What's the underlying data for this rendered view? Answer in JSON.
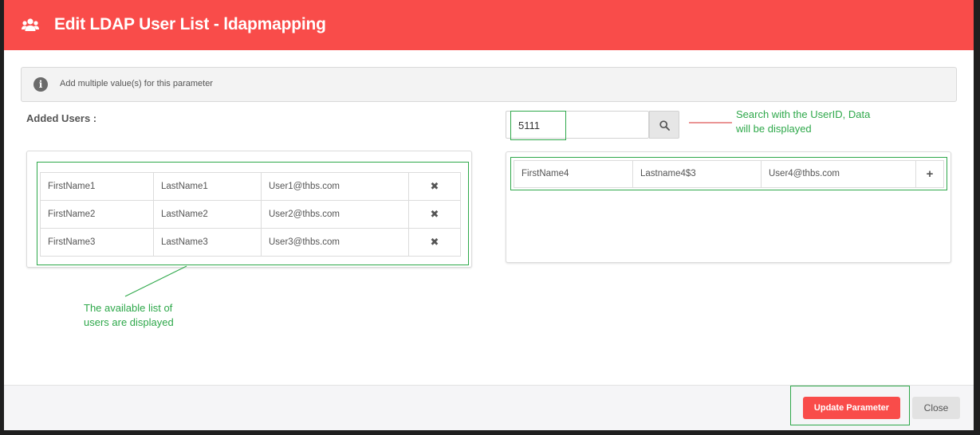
{
  "header": {
    "title": "Edit LDAP User List - ldapmapping",
    "icon": "users-icon",
    "background": "#f94c4a"
  },
  "info_banner": {
    "icon": "info-icon",
    "text": "Add multiple value(s) for this parameter"
  },
  "added_users": {
    "label": "Added Users :",
    "rows": [
      {
        "first_name": "FirstName1",
        "last_name": "LastName1",
        "email": "User1@thbs.com",
        "action_icon": "remove-icon",
        "action_glyph": "✖"
      },
      {
        "first_name": "FirstName2",
        "last_name": "LastName2",
        "email": "User2@thbs.com",
        "action_icon": "remove-icon",
        "action_glyph": "✖"
      },
      {
        "first_name": "FirstName3",
        "last_name": "LastName3",
        "email": "User3@thbs.com",
        "action_icon": "remove-icon",
        "action_glyph": "✖"
      }
    ]
  },
  "search": {
    "value": "5111",
    "button_icon": "search-icon"
  },
  "search_results": {
    "rows": [
      {
        "first_name": "FirstName4",
        "last_name": "Lastname4$3",
        "email": "User4@thbs.com",
        "action_icon": "add-icon",
        "action_glyph": "+"
      }
    ]
  },
  "annotations": {
    "search_note": [
      "Search with the UserID, Data",
      "will be displayed"
    ],
    "list_note": [
      "The available list of",
      "users are displayed"
    ],
    "highlight_color": "#2ea84a",
    "pointer_color": "#d62b2b"
  },
  "footer": {
    "update_label": "Update Parameter",
    "close_label": "Close"
  }
}
